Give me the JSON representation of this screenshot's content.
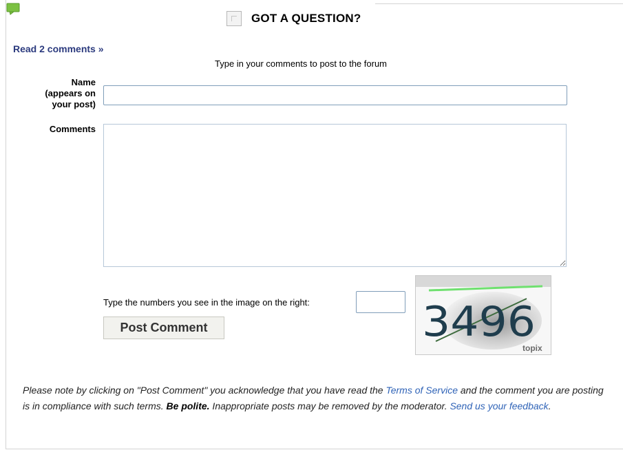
{
  "header": {
    "title": "GOT A QUESTION?",
    "bubble_icon": "speech-bubble-icon",
    "bubble_color": "#7cc142"
  },
  "read_comments_link": "Read 2 comments »",
  "form": {
    "instructions": "Type in your comments to post to the forum",
    "name_label_line1": "Name",
    "name_label_line2": "(appears on",
    "name_label_line3": "your post)",
    "name_value": "",
    "comments_label": "Comments",
    "comments_value": "",
    "captcha_prompt": "Type the numbers you see in the image on the right:",
    "captcha_value": "",
    "captcha_image_text": "3496",
    "captcha_brand": "topix",
    "post_button": "Post Comment"
  },
  "notice": {
    "part1": "Please note by clicking on \"Post Comment\" you acknowledge that you have read the ",
    "tos_link": "Terms of Service",
    "part2": " and the comment you are posting is in compliance with such terms. ",
    "be_polite": "Be polite.",
    "part3": " Inappropriate posts may be removed by the moderator. ",
    "feedback_link": "Send us your feedback",
    "part4": "."
  }
}
